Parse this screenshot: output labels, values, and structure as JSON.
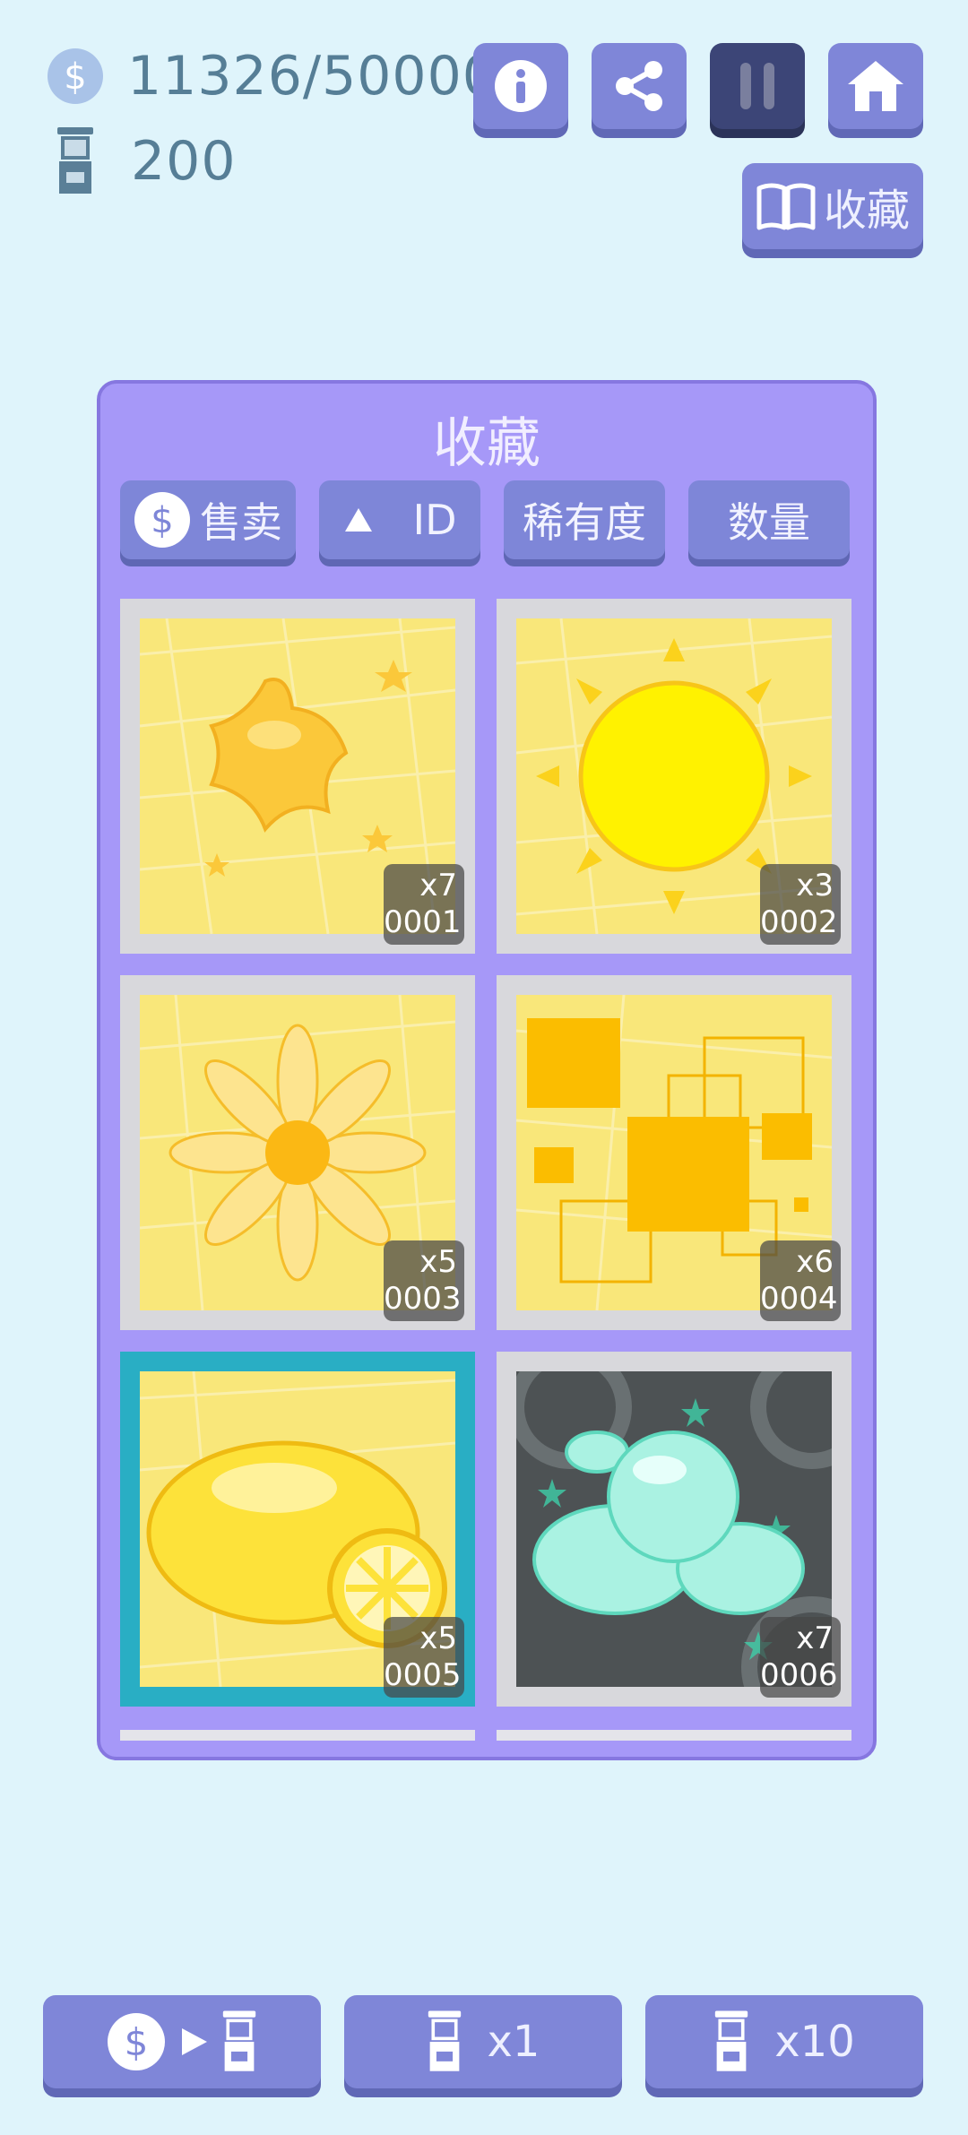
{
  "stats": {
    "coins": "11326/50000",
    "capsules": "200"
  },
  "header": {
    "collection_button": "收藏"
  },
  "panel": {
    "title": "收藏",
    "sort_buttons": {
      "sell": "售卖",
      "id": "ID",
      "rarity": "稀有度",
      "quantity": "数量"
    }
  },
  "cards": [
    {
      "id": "0001",
      "count": "x7",
      "subject": "star-icon"
    },
    {
      "id": "0002",
      "count": "x3",
      "subject": "sun-icon"
    },
    {
      "id": "0003",
      "count": "x5",
      "subject": "flower-icon"
    },
    {
      "id": "0004",
      "count": "x6",
      "subject": "squares-icon"
    },
    {
      "id": "0005",
      "count": "x5",
      "subject": "lemon-icon"
    },
    {
      "id": "0006",
      "count": "x7",
      "subject": "cloud-icon"
    }
  ],
  "bottom": {
    "draw_one": "x1",
    "draw_ten": "x10"
  },
  "colors": {
    "background": "#dff4fb",
    "button": "#7f86d8",
    "panel": "#a698f8",
    "selected": "#29aec4"
  }
}
